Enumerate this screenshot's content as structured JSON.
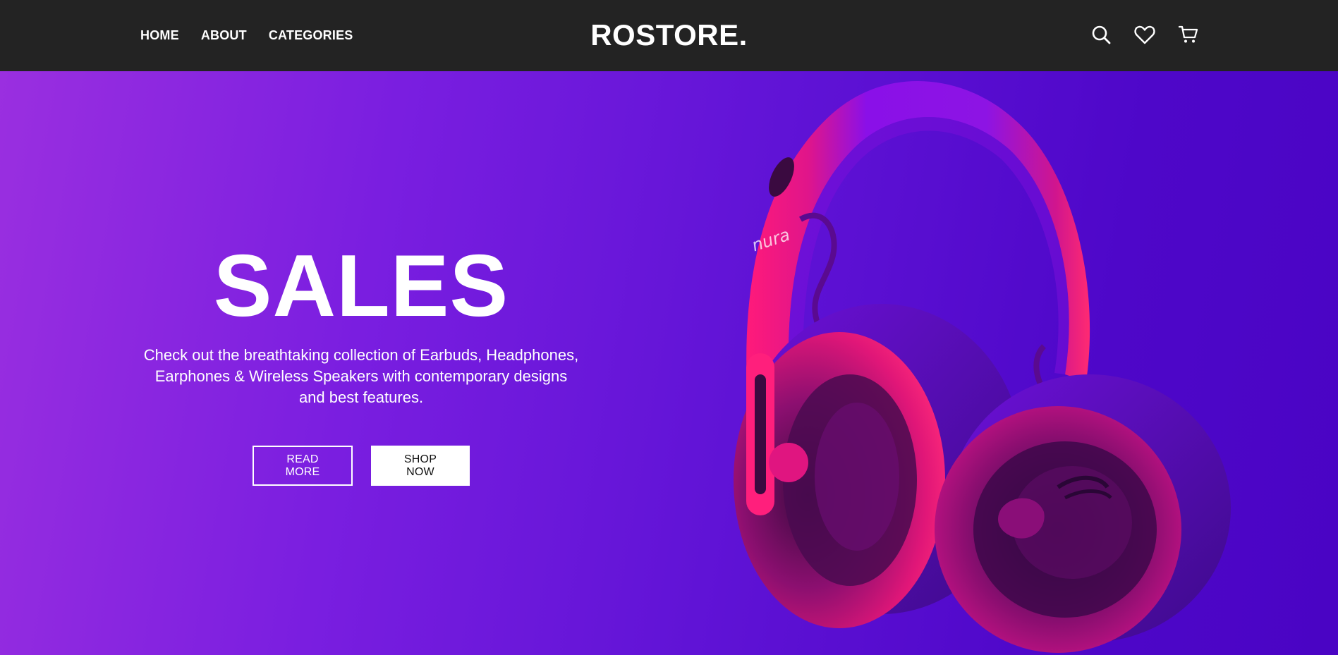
{
  "header": {
    "nav": [
      {
        "label": "HOME"
      },
      {
        "label": "ABOUT"
      },
      {
        "label": "CATEGORIES"
      }
    ],
    "logo": "ROSTORE.",
    "icons": [
      "search-icon",
      "heart-icon",
      "cart-icon"
    ]
  },
  "hero": {
    "title": "SALES",
    "description": "Check out the breathtaking collection of Earbuds, Headphones, Earphones & Wireless Speakers with contemporary designs and best features.",
    "read_more_label": "READ MORE",
    "shop_now_label": "SHOP NOW",
    "product_brand": "nura"
  },
  "colors": {
    "header_bg": "#232323",
    "hero_gradient_start": "#9a2fe0",
    "hero_gradient_end": "#4a04c4",
    "product_pink": "#ff1a7a",
    "text": "#ffffff"
  }
}
